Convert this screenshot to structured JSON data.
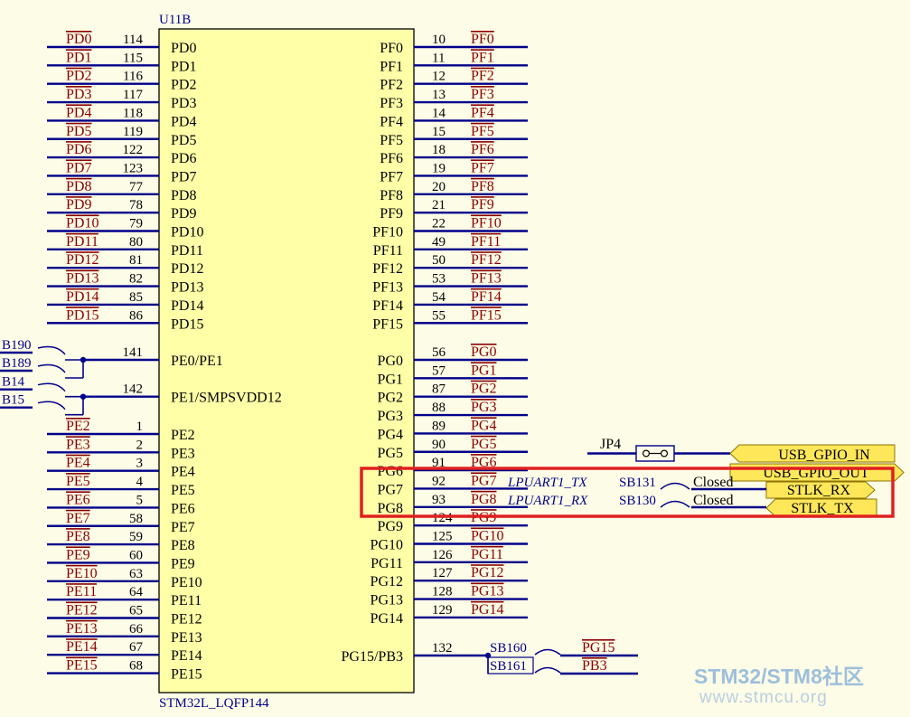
{
  "component": {
    "designator": "U11B",
    "part_name": "STM32L_LQFP144"
  },
  "left_pins_d": [
    {
      "pin": "PD0",
      "num": "114",
      "net": "PD0"
    },
    {
      "pin": "PD1",
      "num": "115",
      "net": "PD1"
    },
    {
      "pin": "PD2",
      "num": "116",
      "net": "PD2"
    },
    {
      "pin": "PD3",
      "num": "117",
      "net": "PD3"
    },
    {
      "pin": "PD4",
      "num": "118",
      "net": "PD4"
    },
    {
      "pin": "PD5",
      "num": "119",
      "net": "PD5"
    },
    {
      "pin": "PD6",
      "num": "122",
      "net": "PD6"
    },
    {
      "pin": "PD7",
      "num": "123",
      "net": "PD7"
    },
    {
      "pin": "PD8",
      "num": "77",
      "net": "PD8"
    },
    {
      "pin": "PD9",
      "num": "78",
      "net": "PD9"
    },
    {
      "pin": "PD10",
      "num": "79",
      "net": "PD10"
    },
    {
      "pin": "PD11",
      "num": "80",
      "net": "PD11"
    },
    {
      "pin": "PD12",
      "num": "81",
      "net": "PD12"
    },
    {
      "pin": "PD13",
      "num": "82",
      "net": "PD13"
    },
    {
      "pin": "PD14",
      "num": "85",
      "net": "PD14"
    },
    {
      "pin": "PD15",
      "num": "86",
      "net": "PD15"
    }
  ],
  "left_pins_e01": [
    {
      "pin": "PE0/PE1",
      "num": "141",
      "bridges": [
        "B190",
        "B189"
      ]
    },
    {
      "pin": "PE1/SMPSVDD12",
      "num": "142",
      "bridges": [
        "B14",
        "B15"
      ]
    }
  ],
  "left_pins_e": [
    {
      "pin": "PE2",
      "num": "1",
      "net": "PE2"
    },
    {
      "pin": "PE3",
      "num": "2",
      "net": "PE3"
    },
    {
      "pin": "PE4",
      "num": "3",
      "net": "PE4"
    },
    {
      "pin": "PE5",
      "num": "4",
      "net": "PE5"
    },
    {
      "pin": "PE6",
      "num": "5",
      "net": "PE6"
    },
    {
      "pin": "PE7",
      "num": "58",
      "net": "PE7"
    },
    {
      "pin": "PE8",
      "num": "59",
      "net": "PE8"
    },
    {
      "pin": "PE9",
      "num": "60",
      "net": "PE9"
    },
    {
      "pin": "PE10",
      "num": "63",
      "net": "PE10"
    },
    {
      "pin": "PE11",
      "num": "64",
      "net": "PE11"
    },
    {
      "pin": "PE12",
      "num": "65",
      "net": "PE12"
    },
    {
      "pin": "PE13",
      "num": "66",
      "net": "PE13"
    },
    {
      "pin": "PE14",
      "num": "67",
      "net": "PE14"
    },
    {
      "pin": "PE15",
      "num": "68",
      "net": "PE15"
    }
  ],
  "right_pins_f": [
    {
      "pin": "PF0",
      "num": "10",
      "net": "PF0"
    },
    {
      "pin": "PF1",
      "num": "11",
      "net": "PF1"
    },
    {
      "pin": "PF2",
      "num": "12",
      "net": "PF2"
    },
    {
      "pin": "PF3",
      "num": "13",
      "net": "PF3"
    },
    {
      "pin": "PF4",
      "num": "14",
      "net": "PF4"
    },
    {
      "pin": "PF5",
      "num": "15",
      "net": "PF5"
    },
    {
      "pin": "PF6",
      "num": "18",
      "net": "PF6"
    },
    {
      "pin": "PF7",
      "num": "19",
      "net": "PF7"
    },
    {
      "pin": "PF8",
      "num": "20",
      "net": "PF8"
    },
    {
      "pin": "PF9",
      "num": "21",
      "net": "PF9"
    },
    {
      "pin": "PF10",
      "num": "22",
      "net": "PF10"
    },
    {
      "pin": "PF11",
      "num": "49",
      "net": "PF11"
    },
    {
      "pin": "PF12",
      "num": "50",
      "net": "PF12"
    },
    {
      "pin": "PF13",
      "num": "53",
      "net": "PF13"
    },
    {
      "pin": "PF14",
      "num": "54",
      "net": "PF14"
    },
    {
      "pin": "PF15",
      "num": "55",
      "net": "PF15"
    }
  ],
  "right_pins_g": [
    {
      "pin": "PG0",
      "num": "56",
      "net": "PG0"
    },
    {
      "pin": "PG1",
      "num": "57",
      "net": "PG1"
    },
    {
      "pin": "PG2",
      "num": "87",
      "net": "PG2"
    },
    {
      "pin": "PG3",
      "num": "88",
      "net": "PG3"
    },
    {
      "pin": "PG4",
      "num": "89",
      "net": "PG4"
    },
    {
      "pin": "PG5",
      "num": "90",
      "net": "PG5"
    },
    {
      "pin": "PG6",
      "num": "91",
      "net": "PG6"
    },
    {
      "pin": "PG7",
      "num": "92",
      "net": "PG7"
    },
    {
      "pin": "PG8",
      "num": "93",
      "net": "PG8"
    },
    {
      "pin": "PG9",
      "num": "124",
      "net": "PG9"
    },
    {
      "pin": "PG10",
      "num": "125",
      "net": "PG10"
    },
    {
      "pin": "PG11",
      "num": "126",
      "net": "PG11"
    },
    {
      "pin": "PG12",
      "num": "127",
      "net": "PG12"
    },
    {
      "pin": "PG13",
      "num": "128",
      "net": "PG13"
    },
    {
      "pin": "PG14",
      "num": "129",
      "net": "PG14"
    }
  ],
  "pg15": {
    "pin": "PG15/PB3",
    "num": "132"
  },
  "jp4": {
    "label": "JP4"
  },
  "ports": {
    "usb_gpio_in": "USB_GPIO_IN",
    "usb_gpio_out": "USB_GPIO_OUT",
    "stlk_rx": "STLK_RX",
    "stlk_tx": "STLK_TX"
  },
  "lpuart": {
    "tx_label": "LPUART1_TX",
    "rx_label": "LPUART1_RX",
    "sb_tx": "SB131",
    "sb_rx": "SB130",
    "state_tx": "Closed",
    "state_rx": "Closed"
  },
  "pg15_bridges": [
    {
      "sb": "SB160",
      "net": "PG15"
    },
    {
      "sb": "SB161",
      "net": "PB3"
    }
  ],
  "watermark": {
    "line1_a": "STM32/STM8",
    "line1_b": "社区",
    "line2": "www.stmcu.org"
  },
  "colors": {
    "body_fill": "#ffffa8",
    "wire": "#00008b",
    "net_label": "#8b0000",
    "highlight": "#e02020",
    "port_fill": "#ffe75a"
  }
}
